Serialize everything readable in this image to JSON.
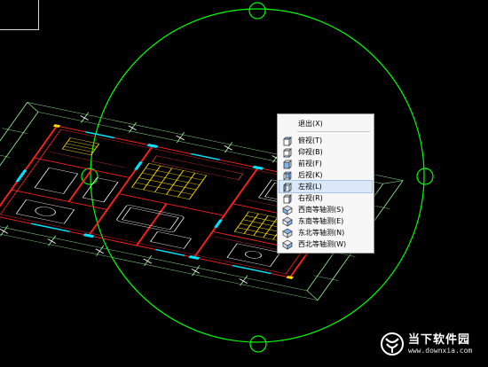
{
  "app": {
    "name": "CAD drawing viewport"
  },
  "viewport": {
    "background": "#000000",
    "colors": {
      "orbit": "#00ff00",
      "walls": "#ff2020",
      "hatch": "#ffd800",
      "doors": "#00e5ff",
      "furniture": "#ffffff",
      "dimensions": "#9cff9c"
    }
  },
  "context_menu": {
    "items": [
      {
        "label": "退出(X)",
        "icon": ""
      },
      {
        "label": "俯视(T)",
        "icon": "top-view-icon"
      },
      {
        "label": "仰视(B)",
        "icon": "bottom-view-icon"
      },
      {
        "label": "前视(F)",
        "icon": "front-view-icon"
      },
      {
        "label": "后视(K)",
        "icon": "back-view-icon"
      },
      {
        "label": "左视(L)",
        "icon": "left-view-icon",
        "highlighted": true
      },
      {
        "label": "右视(R)",
        "icon": "right-view-icon"
      },
      {
        "label": "西南等轴测(S)",
        "icon": "sw-isometric-icon"
      },
      {
        "label": "东南等轴测(E)",
        "icon": "se-isometric-icon"
      },
      {
        "label": "东北等轴测(N)",
        "icon": "ne-isometric-icon"
      },
      {
        "label": "西北等轴测(W)",
        "icon": "nw-isometric-icon"
      }
    ]
  },
  "watermark": {
    "name": "当下软件园",
    "url": "www.downxia.com"
  }
}
